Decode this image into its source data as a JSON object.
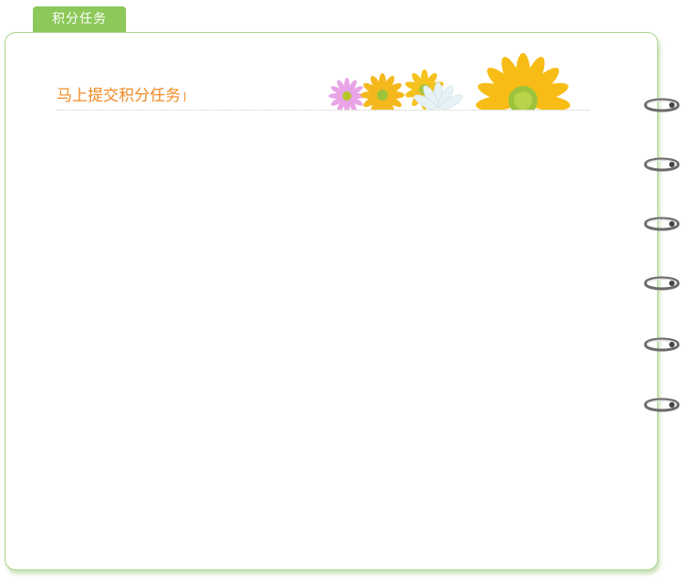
{
  "tab": {
    "label": "积分任务"
  },
  "header": {
    "title": "马上提交积分任务"
  },
  "colors": {
    "accent": "#8cc85a",
    "title": "#f08a24",
    "border": "#a9d48a"
  },
  "decor": {
    "flowers_icon": "daisy-flowers-icon",
    "ring_icon": "binder-ring-icon",
    "ring_count": 6
  }
}
